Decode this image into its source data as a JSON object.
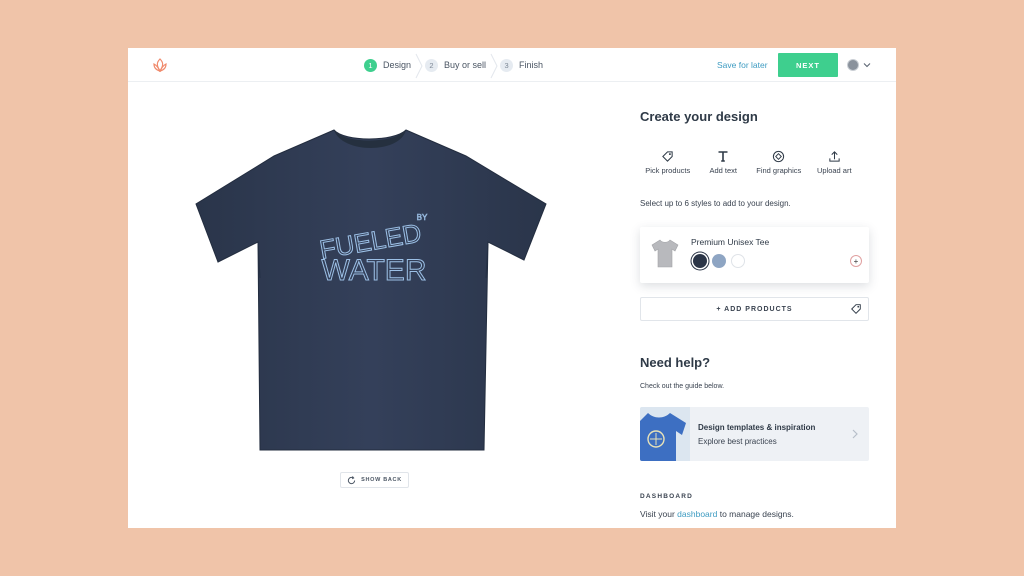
{
  "header": {
    "steps": [
      {
        "num": "1",
        "label": "Design"
      },
      {
        "num": "2",
        "label": "Buy or sell"
      },
      {
        "num": "3",
        "label": "Finish"
      }
    ],
    "save_label": "Save for later",
    "next_label": "NEXT"
  },
  "canvas": {
    "shirt_text_line1": "FUELED",
    "shirt_text_by": "BY",
    "shirt_text_line2": "WATER",
    "show_back_label": "SHOW BACK"
  },
  "panel": {
    "title": "Create your design",
    "tools": [
      {
        "label": "Pick products",
        "icon": "tag-icon"
      },
      {
        "label": "Add text",
        "icon": "text-icon"
      },
      {
        "label": "Find graphics",
        "icon": "graphics-icon"
      },
      {
        "label": "Upload art",
        "icon": "upload-icon"
      }
    ],
    "select_note": "Select up to 6 styles to add to your design.",
    "product": {
      "name": "Premium Unisex Tee",
      "colors": [
        "#2b3547",
        "#8ea5c3",
        "#ffffff"
      ],
      "add_color_symbol": "+"
    },
    "add_products_label": "+ ADD PRODUCTS",
    "help_title": "Need help?",
    "help_note": "Check out the guide below.",
    "guide": {
      "title": "Design templates & inspiration",
      "subtitle": "Explore best practices"
    },
    "dashboard": {
      "label": "DASHBOARD",
      "text_before": "Visit your ",
      "link": "dashboard",
      "text_after": " to manage designs."
    }
  },
  "colors": {
    "background": "#f0c4a9",
    "accent": "#3ecf8e",
    "link": "#3f9cc2",
    "shirt": "#2f3b52",
    "shirt_print": "#9cc0e6"
  }
}
